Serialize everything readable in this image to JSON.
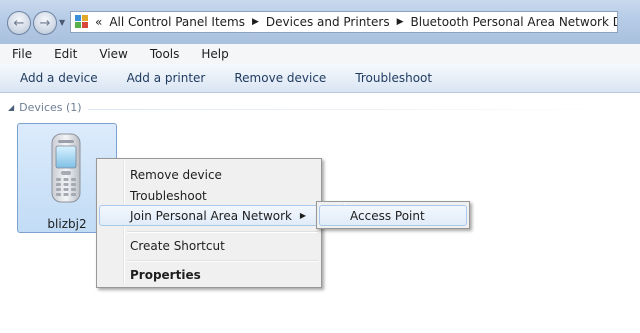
{
  "address_bar": {
    "recent_chevron": "«",
    "breadcrumbs": [
      "All Control Panel Items",
      "Devices and Printers",
      "Bluetooth Personal Area Network Devices"
    ],
    "separator": "▶"
  },
  "menubar": {
    "items": [
      "File",
      "Edit",
      "View",
      "Tools",
      "Help"
    ]
  },
  "command_bar": {
    "buttons": [
      "Add a device",
      "Add a printer",
      "Remove device",
      "Troubleshoot"
    ]
  },
  "group": {
    "header": "Devices (1)"
  },
  "device": {
    "name": "blizbj2",
    "icon": "mobile-phone-icon"
  },
  "context_menu": {
    "items": {
      "remove": "Remove device",
      "troubleshoot": "Troubleshoot",
      "join_pan": "Join Personal Area Network",
      "create_shortcut": "Create Shortcut",
      "properties": "Properties"
    },
    "submenu": {
      "access_point": "Access Point"
    }
  },
  "colors": {
    "title_bar": "#b5cbe6",
    "tile_selected": "#cfe3f9",
    "menu_bg": "#f0f0f0",
    "highlight_border": "#a8c8ec"
  }
}
